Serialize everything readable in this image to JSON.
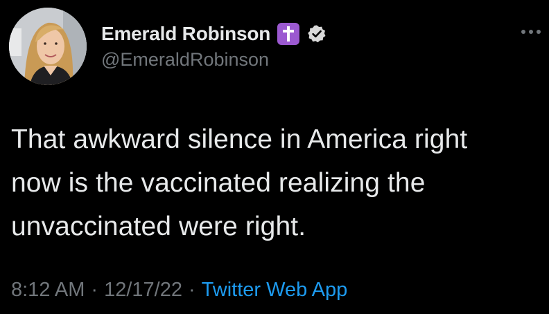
{
  "tweet": {
    "author": {
      "display_name": "Emerald Robinson",
      "handle": "@EmeraldRobinson",
      "name_emoji": "latin-cross-emoji",
      "verified": true,
      "avatar": "profile-photo"
    },
    "text_lines": [
      "That awkward silence in America right",
      "now is the vaccinated realizing the",
      "unvaccinated were right."
    ],
    "time": "8:12 AM",
    "date": "12/17/22",
    "separator": "·",
    "source": "Twitter Web App",
    "more_menu_icon": "more-dots-icon"
  },
  "colors": {
    "background": "#000000",
    "primary_text": "#e7e9ea",
    "secondary_text": "#71767b",
    "link": "#1d9bf0",
    "emoji_purple": "#9b59d0"
  }
}
